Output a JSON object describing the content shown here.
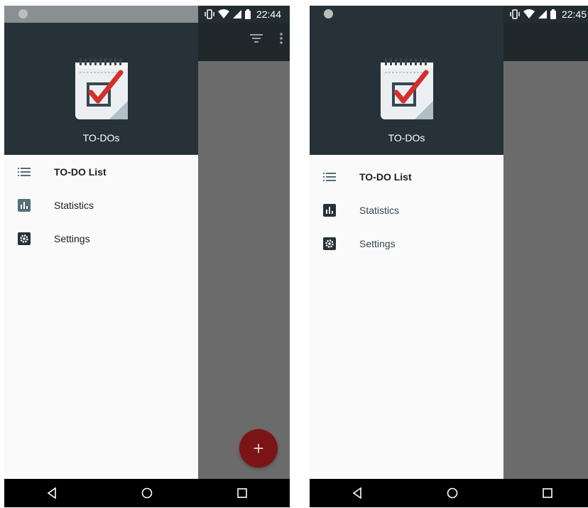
{
  "phone1": {
    "status": {
      "time": "22:44"
    },
    "drawer": {
      "title": "TO-DOs"
    },
    "nav": [
      {
        "label": "TO-DO List",
        "icon": "list-icon"
      },
      {
        "label": "Statistics",
        "icon": "statistics-icon"
      },
      {
        "label": "Settings",
        "icon": "settings-icon"
      }
    ],
    "fab": {
      "icon": "plus-icon",
      "glyph": "+"
    }
  },
  "phone2": {
    "status": {
      "time": "22:45"
    },
    "drawer": {
      "title": "TO-DOs"
    },
    "nav": [
      {
        "label": "TO-DO List",
        "icon": "list-icon"
      },
      {
        "label": "Statistics",
        "icon": "statistics-icon"
      },
      {
        "label": "Settings",
        "icon": "settings-icon"
      }
    ]
  },
  "colors": {
    "drawer_header": "#263238",
    "toolbar": "#1f272b",
    "scrim": "#6b6b6b",
    "fab": "#7b1414",
    "checkmark": "#d32f2f"
  }
}
